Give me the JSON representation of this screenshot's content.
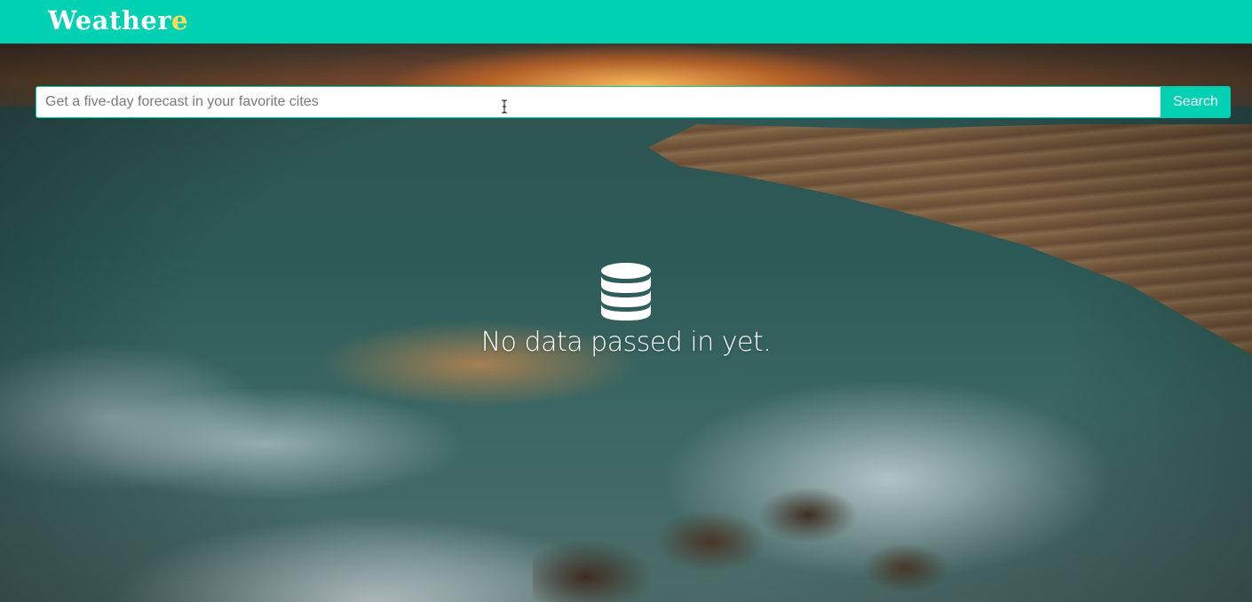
{
  "header": {
    "logo_main": "Weather",
    "logo_accent": "e"
  },
  "search": {
    "placeholder": "Get a five-day forecast in your favorite cites",
    "value": "",
    "button_label": "Search"
  },
  "empty_state": {
    "icon": "database-icon",
    "message": "No data passed in yet."
  },
  "colors": {
    "brand": "#00d1b2",
    "logo_accent": "#ffdd57",
    "text_light": "#ffffff"
  }
}
